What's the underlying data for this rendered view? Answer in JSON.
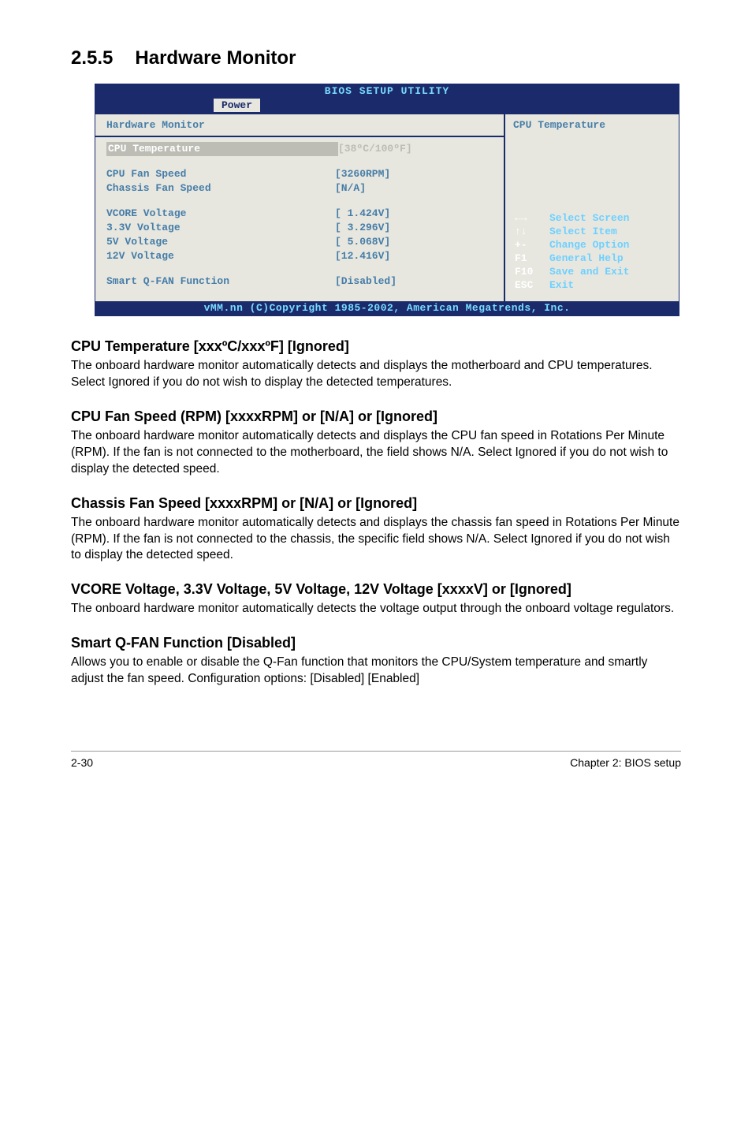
{
  "section": {
    "number": "2.5.5",
    "title": "Hardware Monitor"
  },
  "bios": {
    "utility_title": "BIOS SETUP UTILITY",
    "active_tab": "Power",
    "left_header": "Hardware Monitor",
    "right_header": "CPU Temperature",
    "rows": [
      {
        "label": "CPU Temperature",
        "value": "[38ºC/100ºF]",
        "selected": true
      },
      {
        "gap": true
      },
      {
        "label": "CPU Fan Speed",
        "value": "[3260RPM]"
      },
      {
        "label": "Chassis Fan Speed",
        "value": "[N/A]"
      },
      {
        "gap": true
      },
      {
        "label": "VCORE Voltage",
        "value": "[ 1.424V]"
      },
      {
        "label": "3.3V Voltage",
        "value": "[ 3.296V]"
      },
      {
        "label": "5V Voltage",
        "value": "[ 5.068V]"
      },
      {
        "label": "12V Voltage",
        "value": "[12.416V]"
      },
      {
        "gap": true
      },
      {
        "label": "Smart Q-FAN Function",
        "value": "[Disabled]"
      }
    ],
    "help": [
      {
        "key": "←→",
        "text": "Select Screen"
      },
      {
        "key": "↑↓",
        "text": "Select Item"
      },
      {
        "key": "+-",
        "text": "Change Option"
      },
      {
        "key": "F1",
        "text": "General Help"
      },
      {
        "key": "F10",
        "text": "Save and Exit"
      },
      {
        "key": "ESC",
        "text": "Exit"
      }
    ],
    "footer": "vMM.nn (C)Copyright 1985-2002, American Megatrends, Inc."
  },
  "blocks": [
    {
      "heading": "CPU Temperature [xxxºC/xxxºF] [Ignored]",
      "body": "The onboard hardware monitor automatically detects and displays the motherboard and CPU temperatures. Select Ignored if you do not wish to display the detected temperatures."
    },
    {
      "heading": "CPU Fan Speed (RPM) [xxxxRPM] or [N/A] or [Ignored]",
      "body": "The onboard hardware monitor automatically detects and displays the CPU fan speed in Rotations Per Minute (RPM). If the fan is not connected to the motherboard, the field shows N/A. Select Ignored if you do not wish to display the detected speed."
    },
    {
      "heading": "Chassis Fan Speed [xxxxRPM] or [N/A] or [Ignored]",
      "body": "The onboard hardware monitor automatically detects and displays the chassis fan speed in Rotations Per Minute (RPM). If the fan is not connected to the chassis, the specific field shows N/A. Select Ignored if you do not wish to display the detected speed."
    },
    {
      "heading": "VCORE Voltage, 3.3V Voltage, 5V Voltage, 12V Voltage [xxxxV] or [Ignored]",
      "body": "The onboard hardware monitor automatically detects the voltage output through the onboard voltage regulators."
    },
    {
      "heading": "Smart Q-FAN Function [Disabled]",
      "body": "Allows you to enable or disable the Q-Fan function that monitors the CPU/System temperature and smartly adjust the fan speed. Configuration options: [Disabled] [Enabled]"
    }
  ],
  "page_footer": {
    "left": "2-30",
    "right": "Chapter 2: BIOS setup"
  }
}
